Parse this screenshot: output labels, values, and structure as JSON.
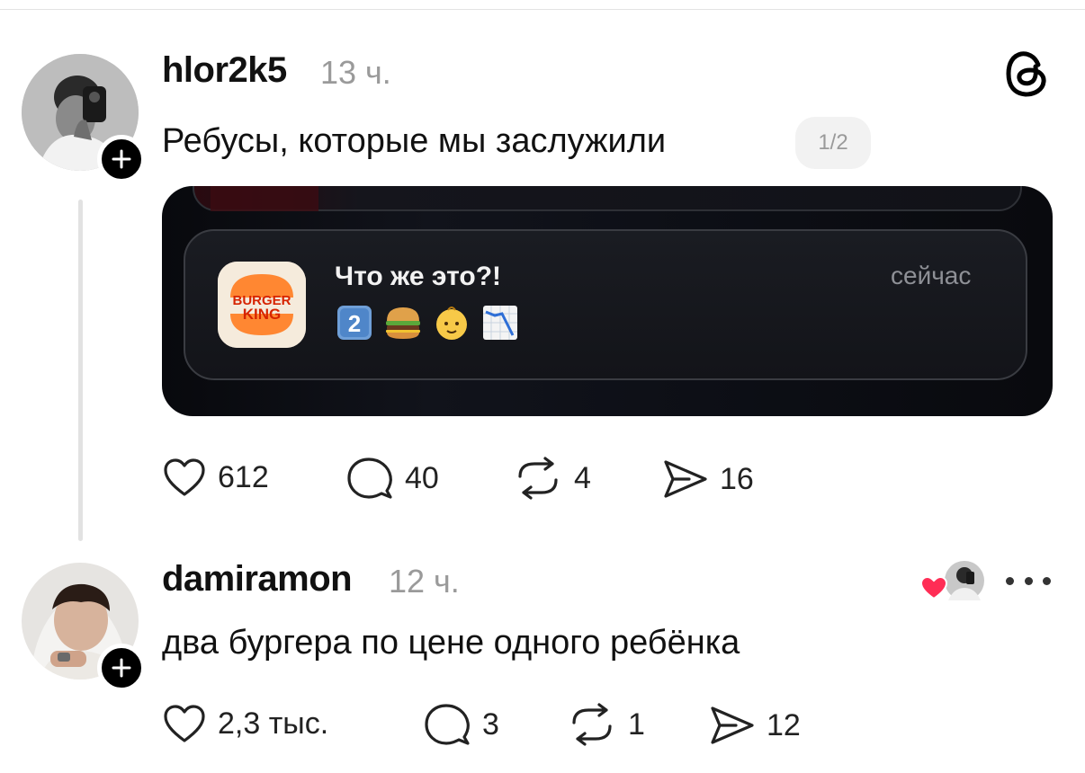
{
  "post": {
    "username": "hlor2k5",
    "time": "13 ч.",
    "text": "Ребусы, которые мы заслужили",
    "carousel_counter": "1/2",
    "image": {
      "notification_title": "Что же это?!",
      "notification_time": "сейчас",
      "app_icon_text": [
        "BURGER",
        "KING"
      ],
      "emojis": [
        "keycap-2",
        "hamburger",
        "baby",
        "chart-decreasing"
      ]
    },
    "actions": {
      "likes": "612",
      "replies": "40",
      "reposts": "4",
      "shares": "16"
    }
  },
  "reply": {
    "username": "damiramon",
    "time": "12 ч.",
    "text": "два бургера по цене одного ребёнка",
    "actions": {
      "likes": "2,3 тыс.",
      "replies": "3",
      "reposts": "1",
      "shares": "12"
    }
  },
  "icons": {
    "follow": "plus-icon",
    "brand": "threads-logo-icon",
    "like": "heart-icon",
    "reply": "comment-icon",
    "repost": "repost-icon",
    "share": "send-icon",
    "more": "ellipsis-icon"
  },
  "colors": {
    "background": "#ffffff",
    "text": "#111111",
    "muted": "#9a9a9a",
    "heart": "#ff2d55"
  }
}
